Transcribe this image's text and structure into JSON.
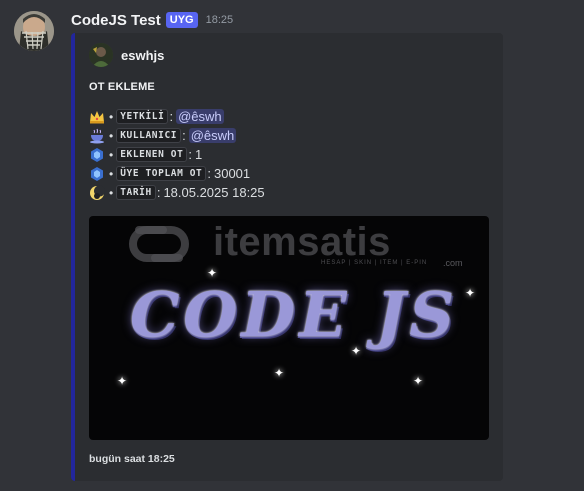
{
  "message": {
    "username": "CodeJS Test",
    "app_tag": "UYG",
    "timestamp": "18:25"
  },
  "embed": {
    "accent_color": "#22269c",
    "author": "eswhjs",
    "title": "OT EKLEME",
    "fields": [
      {
        "emoji": "crown-icon",
        "label": "YETKİLİ",
        "value": "@êswh",
        "mention": true
      },
      {
        "emoji": "coffee-icon",
        "label": "KULLANICI",
        "value": "@êswh",
        "mention": true
      },
      {
        "emoji": "gem-icon",
        "label": "EKLENEN OT",
        "value": "1",
        "mention": false
      },
      {
        "emoji": "gem-icon",
        "label": "ÜYE TOPLAM OT",
        "value": "30001",
        "mention": false
      },
      {
        "emoji": "moon-icon",
        "label": "TARİH",
        "value": "18.05.2025 18:25",
        "mention": false
      }
    ],
    "image": {
      "watermark": "itemsatis",
      "watermark_sub": "HESAP | SKIN | ITEM | E-PIN",
      "watermark_domain": ".com",
      "logo_text": "CODE JS"
    },
    "footer": "bugün saat 18:25"
  },
  "colors": {
    "background": "#313338",
    "embed_background": "#2b2d31",
    "app_tag": "#5865f2"
  }
}
